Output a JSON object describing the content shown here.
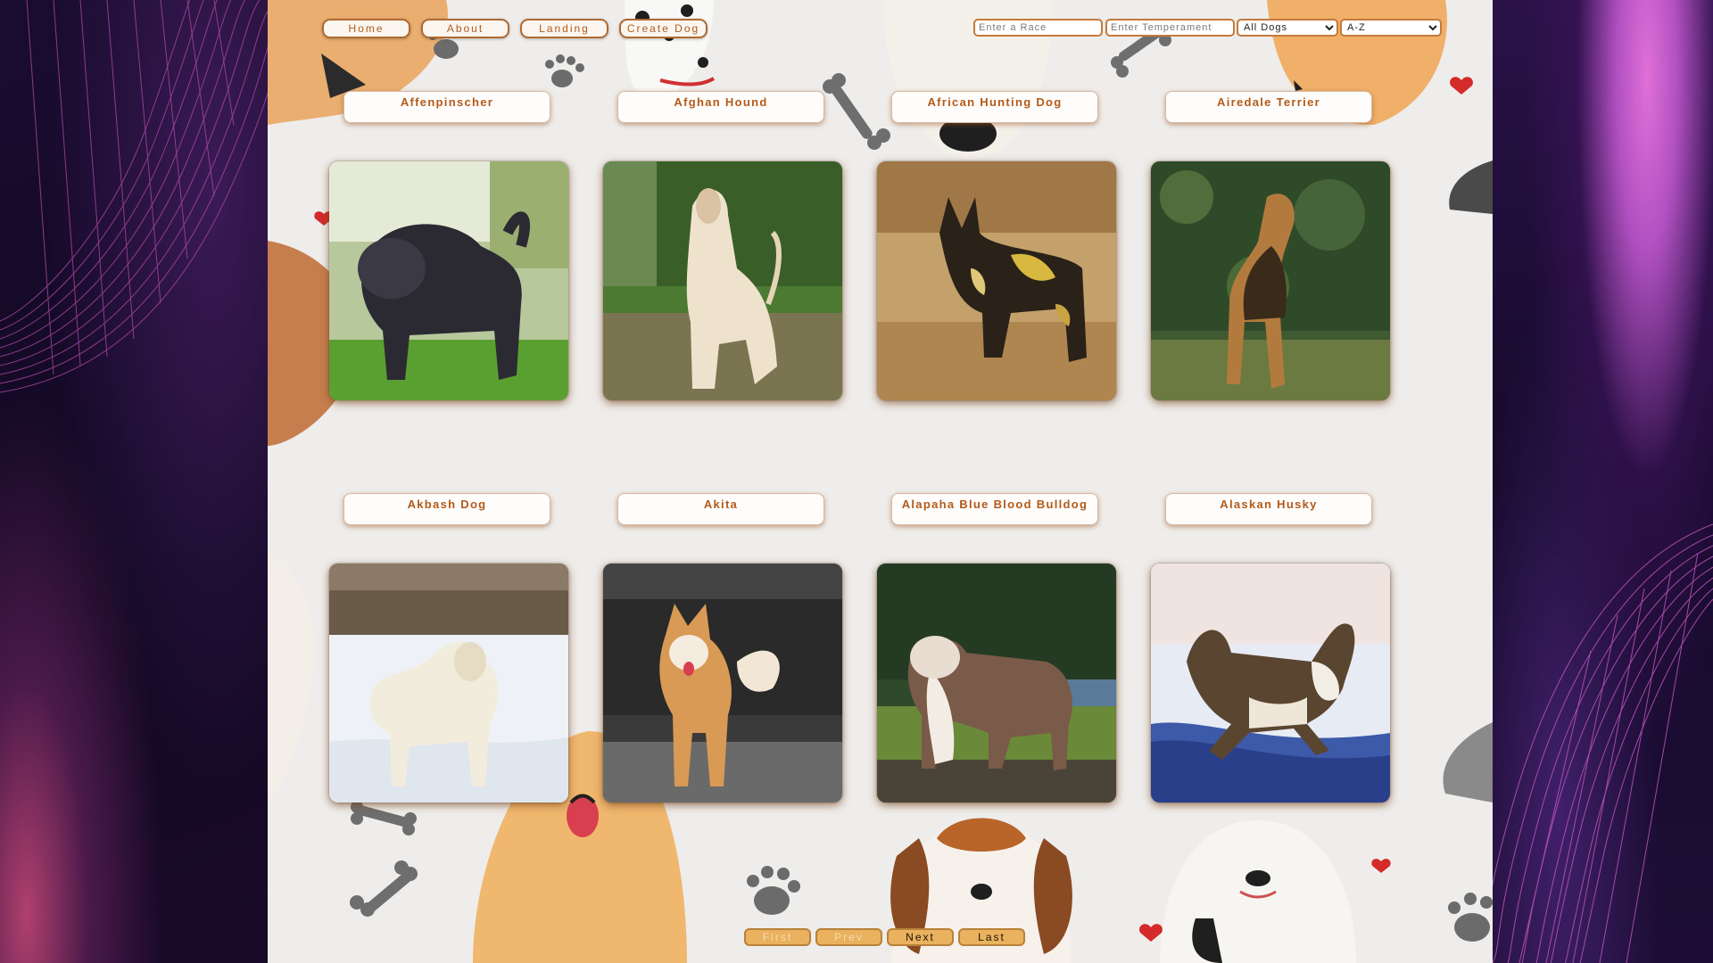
{
  "nav": {
    "home_label": "Home",
    "about_label": "About",
    "landing_label": "Landing",
    "create_label": "Create Dog"
  },
  "filters": {
    "race_placeholder": "Enter a Race",
    "temperament_placeholder": "Enter Temperament",
    "source_selected": "All Dogs",
    "order_selected": "A-Z"
  },
  "dogs": [
    {
      "name": "Affenpinscher",
      "image": "dark shaggy dog on grass"
    },
    {
      "name": "Afghan Hound",
      "image": "long-haired cream hound in park"
    },
    {
      "name": "African Hunting Dog",
      "image": "painted wild dog in dry grass"
    },
    {
      "name": "Airedale Terrier",
      "image": "tan and black terrier by ivy"
    },
    {
      "name": "Akbash Dog",
      "image": "white dog in snow"
    },
    {
      "name": "Akita",
      "image": "red and white akita on pavement"
    },
    {
      "name": "Alapaha Blue Blood Bulldog",
      "image": "brown and white bulldog on grass"
    },
    {
      "name": "Alaskan Husky",
      "image": "husky running in snow"
    }
  ],
  "pagination": {
    "first_label": "First",
    "prev_label": "Prev",
    "next_label": "Next",
    "last_label": "Last"
  },
  "colors": {
    "accent": "#b3591a",
    "page_button": "#eab15e",
    "panel": "#efedeb",
    "outer_background": "#140a26"
  }
}
